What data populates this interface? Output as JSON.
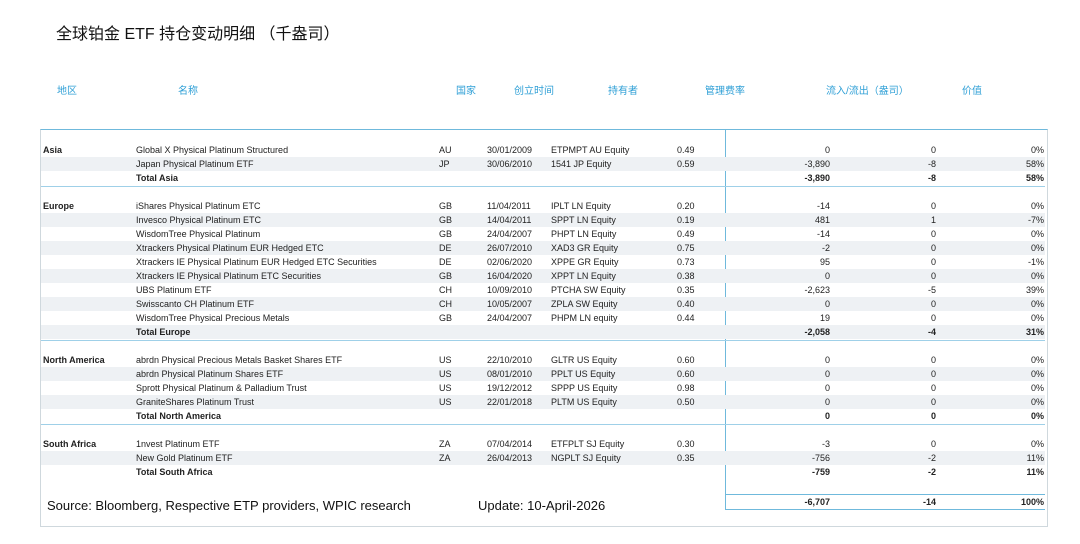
{
  "title": "全球铂金 ETF 持仓变动明细 （千盎司）",
  "columns": {
    "region": "地区",
    "name": "名称",
    "country": "国家",
    "inception": "创立时间",
    "holder": "持有者",
    "fee": "管理费率",
    "flow": "流入/流出（盎司）",
    "value": "价值"
  },
  "rows": [
    {
      "type": "data",
      "region": "Asia",
      "name": "Global X Physical Platinum Structured",
      "country": "AU",
      "date": "30/01/2009",
      "ticker": "ETPMPT AU Equity",
      "fee": "0.49",
      "v1": "0",
      "v2": "0",
      "pct": "0%"
    },
    {
      "type": "data",
      "region": "",
      "name": "Japan Physical Platinum ETF",
      "country": "JP",
      "date": "30/06/2010",
      "ticker": "1541 JP Equity",
      "fee": "0.59",
      "v1": "-3,890",
      "v2": "-8",
      "pct": "58%"
    },
    {
      "type": "total",
      "region": "",
      "name": "Total Asia",
      "country": "",
      "date": "",
      "ticker": "",
      "fee": "",
      "v1": "-3,890",
      "v2": "-8",
      "pct": "58%"
    },
    {
      "type": "gap"
    },
    {
      "type": "data",
      "region": "Europe",
      "name": "iShares Physical Platinum ETC",
      "country": "GB",
      "date": "11/04/2011",
      "ticker": "IPLT LN Equity",
      "fee": "0.20",
      "v1": "-14",
      "v2": "0",
      "pct": "0%"
    },
    {
      "type": "data",
      "region": "",
      "name": "Invesco Physical Platinum ETC",
      "country": "GB",
      "date": "14/04/2011",
      "ticker": "SPPT LN Equity",
      "fee": "0.19",
      "v1": "481",
      "v2": "1",
      "pct": "-7%"
    },
    {
      "type": "data",
      "region": "",
      "name": "WisdomTree Physical Platinum",
      "country": "GB",
      "date": "24/04/2007",
      "ticker": "PHPT LN Equity",
      "fee": "0.49",
      "v1": "-14",
      "v2": "0",
      "pct": "0%"
    },
    {
      "type": "data",
      "region": "",
      "name": "Xtrackers Physical Platinum EUR Hedged ETC",
      "country": "DE",
      "date": "26/07/2010",
      "ticker": "XAD3 GR Equity",
      "fee": "0.75",
      "v1": "-2",
      "v2": "0",
      "pct": "0%"
    },
    {
      "type": "data",
      "region": "",
      "name": "Xtrackers IE Physical Platinum EUR Hedged ETC Securities",
      "country": "DE",
      "date": "02/06/2020",
      "ticker": "XPPE GR Equity",
      "fee": "0.73",
      "v1": "95",
      "v2": "0",
      "pct": "-1%"
    },
    {
      "type": "data",
      "region": "",
      "name": "Xtrackers IE Physical Platinum ETC Securities",
      "country": "GB",
      "date": "16/04/2020",
      "ticker": "XPPT LN Equity",
      "fee": "0.38",
      "v1": "0",
      "v2": "0",
      "pct": "0%"
    },
    {
      "type": "data",
      "region": "",
      "name": "UBS Platinum ETF",
      "country": "CH",
      "date": "10/09/2010",
      "ticker": "PTCHA SW Equity",
      "fee": "0.35",
      "v1": "-2,623",
      "v2": "-5",
      "pct": "39%"
    },
    {
      "type": "data",
      "region": "",
      "name": "Swisscanto CH Platinum ETF",
      "country": "CH",
      "date": "10/05/2007",
      "ticker": "ZPLA SW Equity",
      "fee": "0.40",
      "v1": "0",
      "v2": "0",
      "pct": "0%"
    },
    {
      "type": "data",
      "region": "",
      "name": "WisdomTree Physical Precious Metals",
      "country": "GB",
      "date": "24/04/2007",
      "ticker": "PHPM LN equity",
      "fee": "0.44",
      "v1": "19",
      "v2": "0",
      "pct": "0%"
    },
    {
      "type": "total",
      "region": "",
      "name": "Total Europe",
      "country": "",
      "date": "",
      "ticker": "",
      "fee": "",
      "v1": "-2,058",
      "v2": "-4",
      "pct": "31%"
    },
    {
      "type": "gap"
    },
    {
      "type": "data",
      "region": "North America",
      "name": "abrdn Physical Precious Metals Basket Shares ETF",
      "country": "US",
      "date": "22/10/2010",
      "ticker": "GLTR US Equity",
      "fee": "0.60",
      "v1": "0",
      "v2": "0",
      "pct": "0%"
    },
    {
      "type": "data",
      "region": "",
      "name": "abrdn Physical Platinum Shares ETF",
      "country": "US",
      "date": "08/01/2010",
      "ticker": "PPLT US Equity",
      "fee": "0.60",
      "v1": "0",
      "v2": "0",
      "pct": "0%"
    },
    {
      "type": "data",
      "region": "",
      "name": "Sprott Physical Platinum & Palladium Trust",
      "country": "US",
      "date": "19/12/2012",
      "ticker": "SPPP US Equity",
      "fee": "0.98",
      "v1": "0",
      "v2": "0",
      "pct": "0%"
    },
    {
      "type": "data",
      "region": "",
      "name": "GraniteShares Platinum Trust",
      "country": "US",
      "date": "22/01/2018",
      "ticker": "PLTM US Equity",
      "fee": "0.50",
      "v1": "0",
      "v2": "0",
      "pct": "0%"
    },
    {
      "type": "total",
      "region": "",
      "name": "Total North America",
      "country": "",
      "date": "",
      "ticker": "",
      "fee": "",
      "v1": "0",
      "v2": "0",
      "pct": "0%"
    },
    {
      "type": "gap"
    },
    {
      "type": "data",
      "region": "South Africa",
      "name": "1nvest Platinum ETF",
      "country": "ZA",
      "date": "07/04/2014",
      "ticker": "ETFPLT SJ Equity",
      "fee": "0.30",
      "v1": "-3",
      "v2": "0",
      "pct": "0%"
    },
    {
      "type": "data",
      "region": "",
      "name": "New Gold Platinum ETF",
      "country": "ZA",
      "date": "26/04/2013",
      "ticker": "NGPLT SJ Equity",
      "fee": "0.35",
      "v1": "-756",
      "v2": "-2",
      "pct": "11%"
    },
    {
      "type": "total",
      "region": "",
      "name": "Total South Africa",
      "country": "",
      "date": "",
      "ticker": "",
      "fee": "",
      "v1": "-759",
      "v2": "-2",
      "pct": "11%"
    }
  ],
  "grand_total": {
    "v1": "-6,707",
    "v2": "-14",
    "pct": "100%"
  },
  "source": "Source: Bloomberg, Respective ETP providers, WPIC research",
  "update": "Update:  10-April-2026",
  "colors": {
    "header": "#2e9fd6",
    "rule": "#6fb9dc",
    "shade": "#eef1f4"
  }
}
